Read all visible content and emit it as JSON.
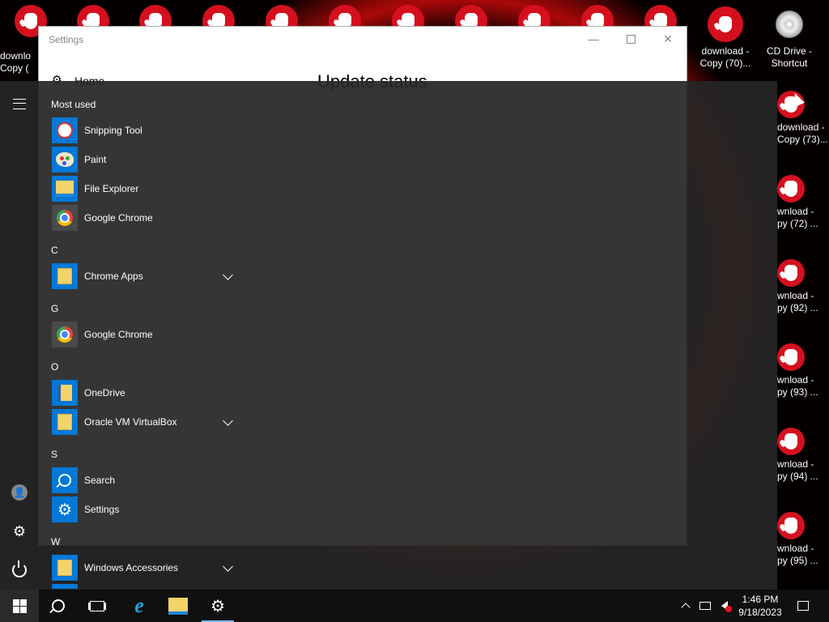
{
  "desktop": {
    "top_icons_count": 11,
    "icons": [
      {
        "label": "downlo\nCopy (",
        "kind": "hand"
      },
      {
        "label": "download -\nCopy (70)...",
        "kind": "hand"
      },
      {
        "label": "CD Drive -\nShortcut",
        "kind": "cd"
      }
    ],
    "side_icons": [
      {
        "label1": "download -",
        "label2": "Copy (73)..."
      },
      {
        "label1": "wnload -",
        "label2": "py (72) ..."
      },
      {
        "label1": "wnload -",
        "label2": "py (92) ..."
      },
      {
        "label1": "wnload -",
        "label2": "py (93) ..."
      },
      {
        "label1": "wnload -",
        "label2": "py (94) ..."
      },
      {
        "label1": "wnload -",
        "label2": "py (95) ..."
      }
    ]
  },
  "settings_window": {
    "title": "Settings",
    "home_label": "Home",
    "heading": "Update status",
    "minimize": "—",
    "close": "✕"
  },
  "start_menu": {
    "rail": {
      "expand_icon": "hamburger-icon",
      "user_glyph": "👤",
      "settings_glyph": "⚙"
    },
    "most_used_label": "Most used",
    "most_used": [
      {
        "label": "Snipping Tool",
        "icon": "snipping-tool-icon"
      },
      {
        "label": "Paint",
        "icon": "paint-icon"
      },
      {
        "label": "File Explorer",
        "icon": "file-explorer-icon"
      },
      {
        "label": "Google Chrome",
        "icon": "chrome-icon"
      }
    ],
    "groups": [
      {
        "letter": "C",
        "items": [
          {
            "label": "Chrome Apps",
            "expandable": true
          }
        ]
      },
      {
        "letter": "G",
        "items": [
          {
            "label": "Google Chrome",
            "expandable": false
          }
        ]
      },
      {
        "letter": "O",
        "items": [
          {
            "label": "OneDrive",
            "expandable": false
          },
          {
            "label": "Oracle VM VirtualBox",
            "expandable": true
          }
        ]
      },
      {
        "letter": "S",
        "items": [
          {
            "label": "Search",
            "expandable": false
          },
          {
            "label": "Settings",
            "expandable": false
          }
        ]
      },
      {
        "letter": "W",
        "items": [
          {
            "label": "Windows Accessories",
            "expandable": true
          }
        ]
      }
    ]
  },
  "taskbar": {
    "ie_glyph": "e",
    "settings_glyph": "⚙",
    "time": "1:46 PM",
    "date": "9/18/2023"
  }
}
